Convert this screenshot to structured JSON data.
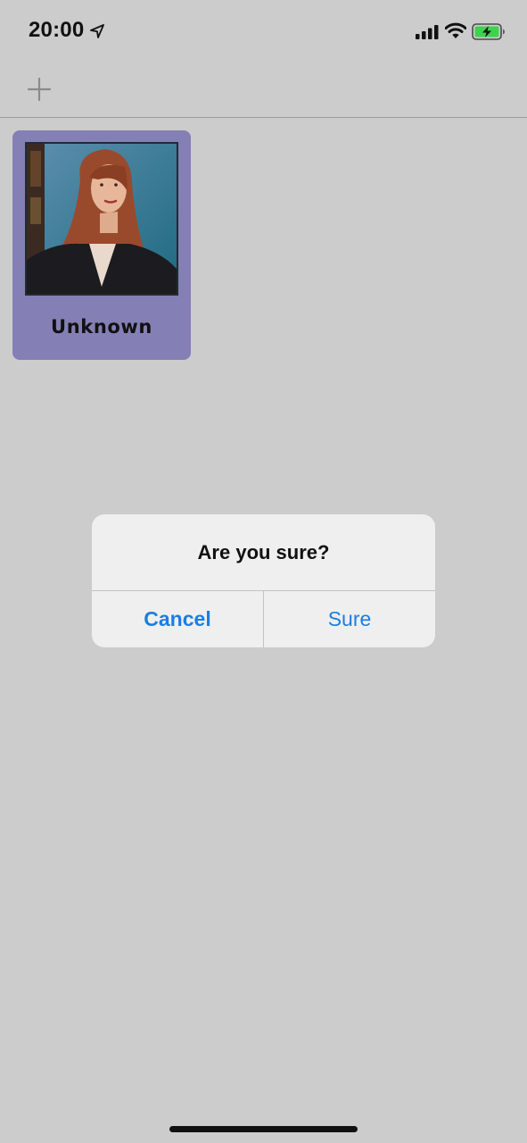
{
  "status_bar": {
    "time": "20:00",
    "icons": [
      "location-arrow-icon",
      "cellular-signal-icon",
      "wifi-icon",
      "battery-charging-icon"
    ],
    "battery_color": "#3fd24f"
  },
  "nav": {
    "add_icon": "plus-icon"
  },
  "card": {
    "name": "Unknown",
    "background": "#8480b5"
  },
  "dialog": {
    "title": "Are you sure?",
    "cancel_label": "Cancel",
    "confirm_label": "Sure",
    "accent_color": "#1b7ee0"
  }
}
